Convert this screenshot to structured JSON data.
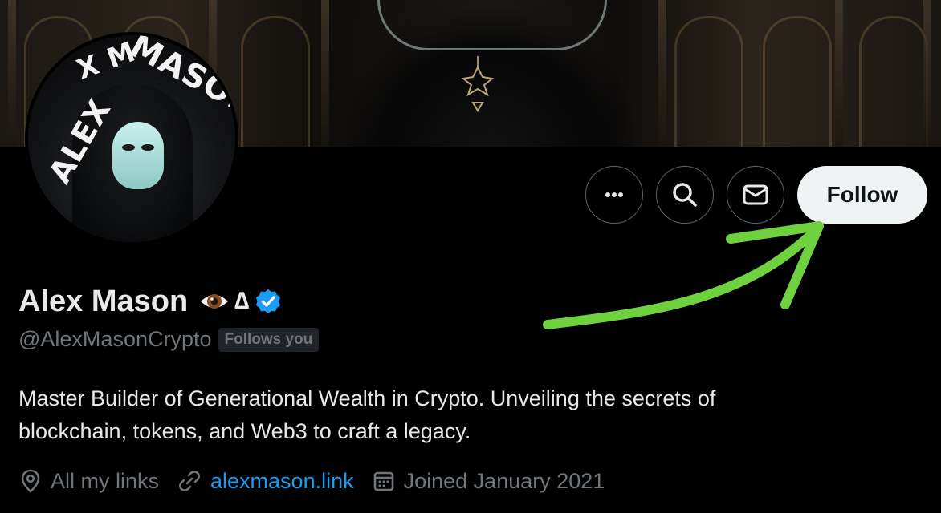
{
  "profile": {
    "name": "Alex Mason",
    "name_symbol": "∆",
    "handle": "@AlexMasonCrypto",
    "follows_you_badge": "Follows you",
    "bio_line1": "Master Builder of Generational Wealth in Crypto. Unveiling the secrets of",
    "bio_line2": "blockchain, tokens, and Web3 to craft a legacy.",
    "avatar_text_1": "MASON",
    "avatar_text_2": "ALEX",
    "avatar_text_3": "X M"
  },
  "meta": {
    "location": "All my links",
    "website": "alexmason.link",
    "joined": "Joined January 2021"
  },
  "actions": {
    "more_icon": "more-horizontal-icon",
    "search_icon": "search-icon",
    "message_icon": "envelope-icon",
    "follow_label": "Follow"
  },
  "colors": {
    "accent": "#1d9bf0",
    "annotation_arrow": "#6fd13e"
  }
}
